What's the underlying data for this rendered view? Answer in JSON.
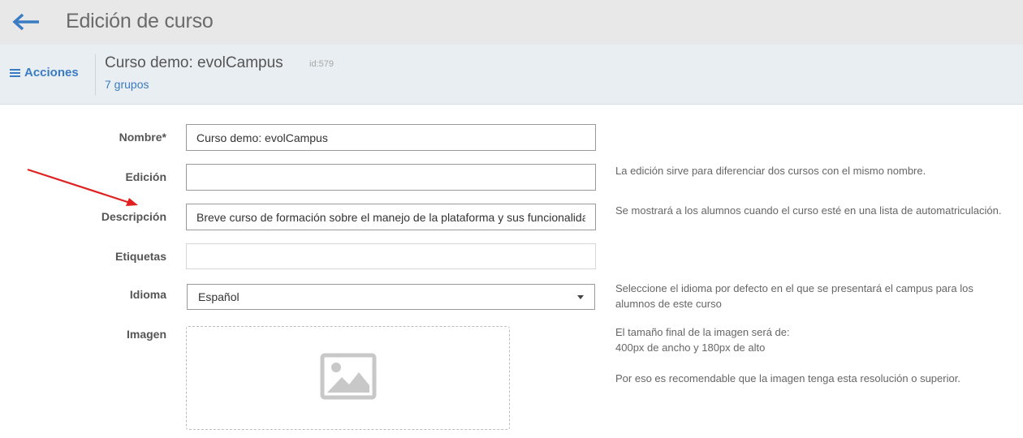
{
  "header": {
    "title": "Edición de curso",
    "back_icon": "arrow-left-icon"
  },
  "subheader": {
    "actions_label": "Acciones",
    "course_name": "Curso demo: evolCampus",
    "course_id": "id:579",
    "groups_link": "7 grupos"
  },
  "form": {
    "nombre": {
      "label": "Nombre*",
      "value": "Curso demo: evolCampus"
    },
    "edicion": {
      "label": "Edición",
      "value": "",
      "help": "La edición sirve para diferenciar dos cursos con el mismo nombre."
    },
    "descripcion": {
      "label": "Descripción",
      "value": "Breve curso de formación sobre el manejo de la plataforma y sus funcionalidades",
      "help": "Se mostrará a los alumnos cuando el curso esté en una lista de automatriculación."
    },
    "etiquetas": {
      "label": "Etiquetas",
      "value": ""
    },
    "idioma": {
      "label": "Idioma",
      "selected": "Español",
      "help_line1": "Seleccione el idioma por defecto en el que se presentará el campus para los",
      "help_line2": "alumnos de este curso"
    },
    "imagen": {
      "label": "Imagen",
      "help_line1": "El tamaño final de la imagen será de:",
      "help_line2": "400px de ancho y 180px de alto",
      "help_line3": "Por eso es recomendable que la imagen tenga esta resolución o superior."
    }
  },
  "colors": {
    "accent": "#3a7cc3",
    "arrow": "#e02020",
    "topbar": "#e8e8e8",
    "subbar": "#e9eef2"
  }
}
